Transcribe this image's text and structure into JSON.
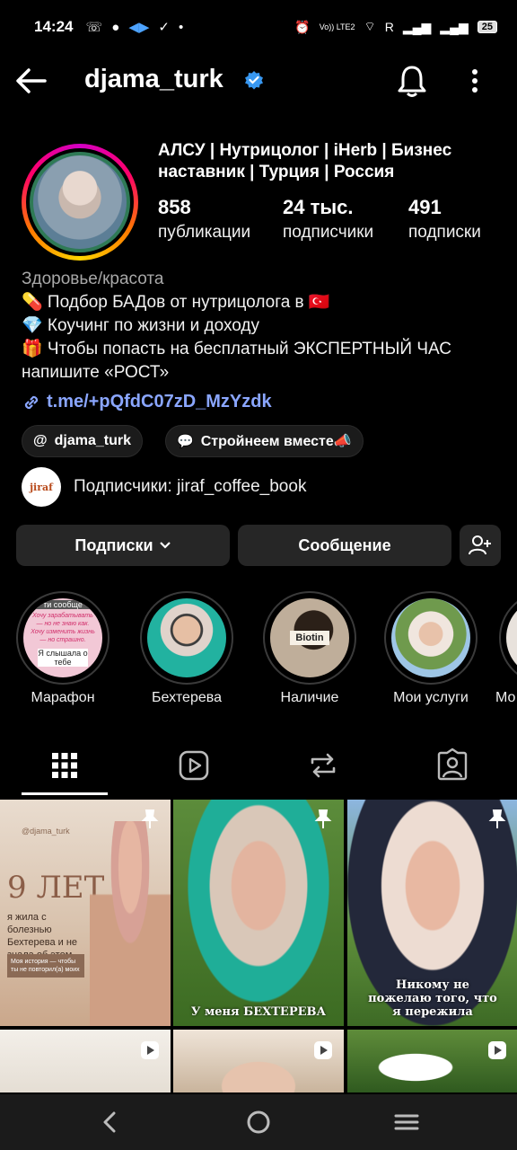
{
  "status_bar": {
    "time": "14:24",
    "carrier_text": "R",
    "network": "Vo)) LTE2",
    "battery": "25"
  },
  "header": {
    "username": "djama_turk"
  },
  "profile": {
    "title": "АЛСУ | Нутрицолог | iHerb | Бизнес наставник | Турция | Россия",
    "stats": [
      {
        "value": "858",
        "label": "публикации"
      },
      {
        "value": "24 тыс.",
        "label": "подписчики"
      },
      {
        "value": "491",
        "label": "подписки"
      }
    ],
    "category": "Здоровье/красота",
    "bio_lines": [
      "💊 Подбор БАДов от нутрицолога в 🇹🇷",
      "💎 Коучинг по жизни и доходу",
      "🎁 Чтобы попасть на бесплатный ЭКСПЕРТНЫЙ ЧАС",
      "напишите «РОСТ»"
    ],
    "link": "t.me/+pQfdC07zD_MzYzdk"
  },
  "chips": [
    {
      "label": "djama_turk"
    },
    {
      "label": "Стройнеем вместе📣"
    }
  ],
  "followed_by": {
    "avatar_text": "jiraf",
    "text": "Подписчики: jiraf_coffee_book"
  },
  "buttons": {
    "following": "Подписки",
    "message": "Сообщение"
  },
  "highlights": [
    {
      "label": "Марафон"
    },
    {
      "label": "Бехтерева"
    },
    {
      "label": "Наличие"
    },
    {
      "label": "Мои услуги"
    },
    {
      "label": "Мо"
    }
  ],
  "grid_posts": [
    {
      "top_label": "@djama_turk",
      "headline": "9 ЛЕТ",
      "sub": "я жила с болезнью Бехтерева и не знала об этом.",
      "box": "Моя история — чтобы ты не повторил(а) моих"
    },
    {
      "caption": "У меня БЕХТЕРЕВА"
    },
    {
      "caption": "Никому не пожелаю того, что я пережила"
    }
  ],
  "highlight_text": {
    "first_top": "ти сообще",
    "first_mid": "Хочу зарабатывать — но не знаю как. Хочу изменить жизнь — но страшно.",
    "first_bottom": "Я слышала о тебе",
    "bottle": "Biotin"
  }
}
